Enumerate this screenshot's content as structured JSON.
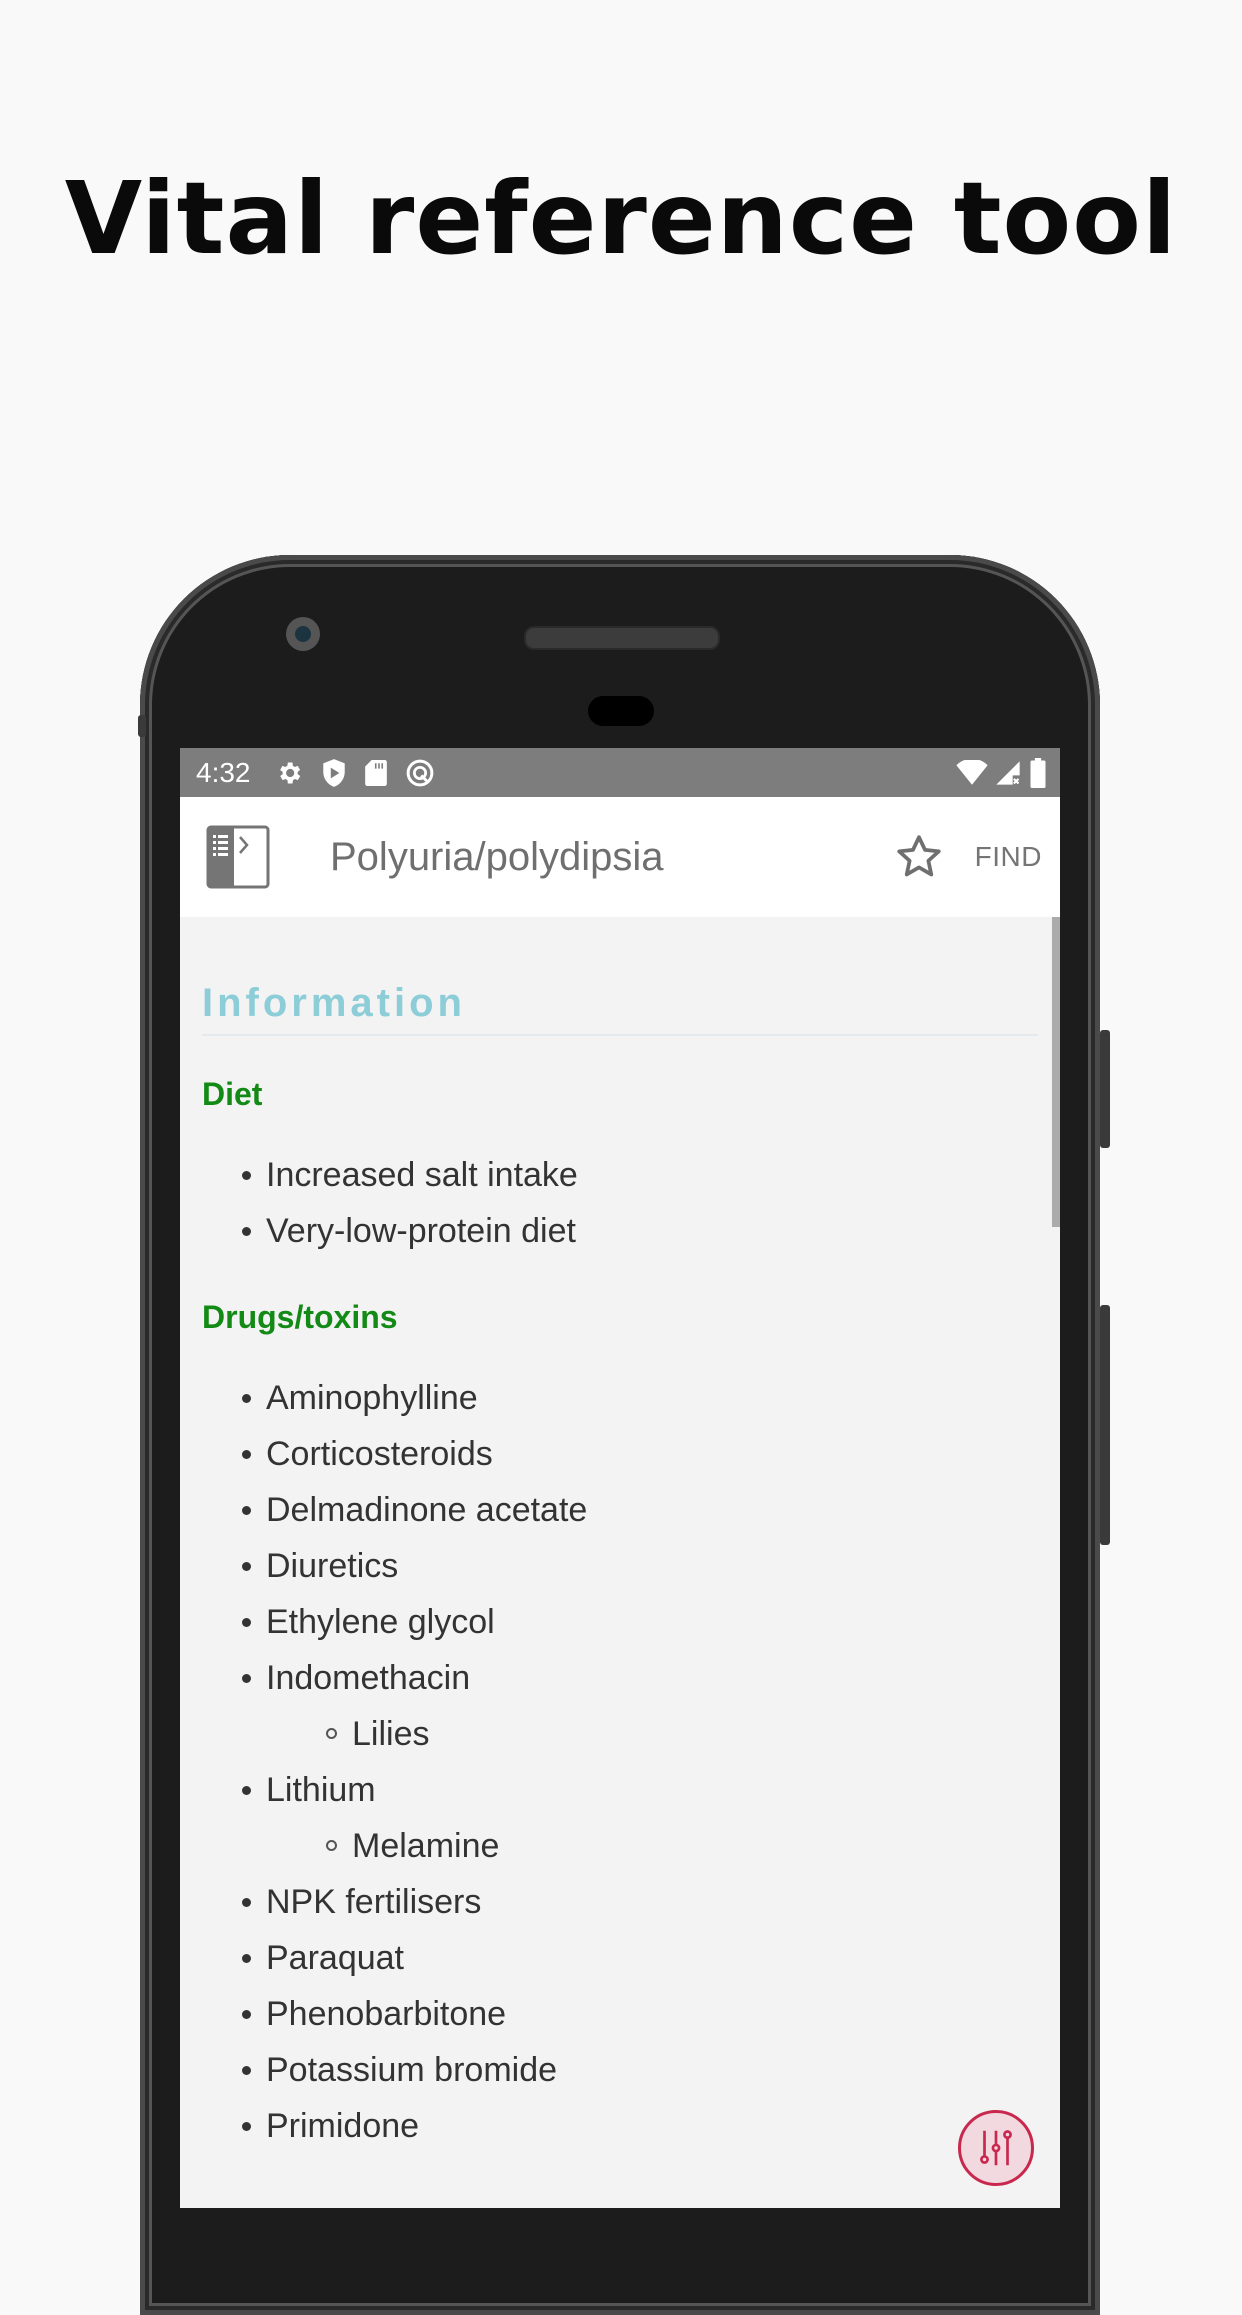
{
  "headline": "Vital reference tool",
  "statusbar": {
    "time": "4:32",
    "left_icons": [
      "settings-icon",
      "shield-play-icon",
      "sd-card-icon",
      "data-saver-icon"
    ],
    "right_icons": [
      "wifi-icon",
      "signal-no-data-icon",
      "battery-icon"
    ]
  },
  "appbar": {
    "title": "Polyuria/polydipsia",
    "toc_icon": "table-of-contents-icon",
    "favorite_icon": "star-outline-icon",
    "find_label": "FIND"
  },
  "content": {
    "section_title": "Information",
    "groups": [
      {
        "heading": "Diet",
        "items": [
          {
            "label": "Increased salt intake",
            "level": 1
          },
          {
            "label": "Very-low-protein diet",
            "level": 1
          }
        ]
      },
      {
        "heading": "Drugs/toxins",
        "items": [
          {
            "label": "Aminophylline",
            "level": 1
          },
          {
            "label": "Corticosteroids",
            "level": 1
          },
          {
            "label": "Delmadinone acetate",
            "level": 1
          },
          {
            "label": "Diuretics",
            "level": 1
          },
          {
            "label": "Ethylene glycol",
            "level": 1
          },
          {
            "label": "Indomethacin",
            "level": 1
          },
          {
            "label": "Lilies",
            "level": 2
          },
          {
            "label": "Lithium",
            "level": 1
          },
          {
            "label": "Melamine",
            "level": 2
          },
          {
            "label": "NPK fertilisers",
            "level": 1
          },
          {
            "label": "Paraquat",
            "level": 1
          },
          {
            "label": "Phenobarbitone",
            "level": 1
          },
          {
            "label": "Potassium bromide",
            "level": 1
          },
          {
            "label": "Primidone",
            "level": 1
          }
        ]
      }
    ]
  },
  "fab": {
    "icon": "sliders-icon"
  },
  "colors": {
    "section_title": "#8ccdd8",
    "subheading": "#138a16",
    "fab_accent": "#c8284e",
    "statusbar": "#7d7d7d"
  }
}
